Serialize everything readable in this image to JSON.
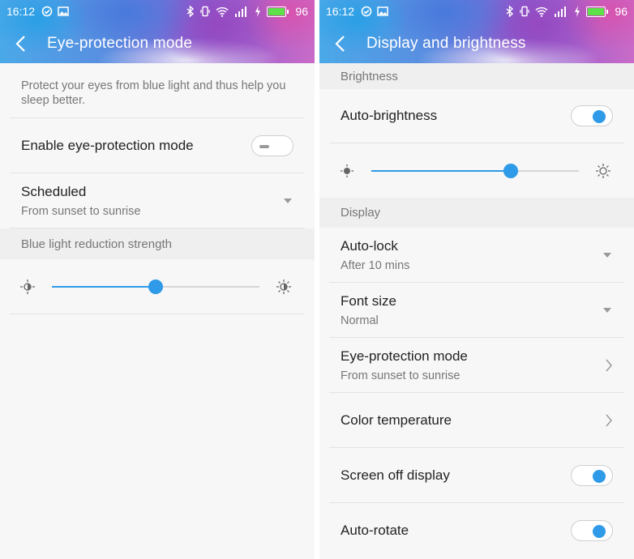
{
  "status_bar": {
    "time": "16:12",
    "battery": "96",
    "battery_level": 0.96,
    "left_icons": [
      "check-circle-icon",
      "image-icon"
    ],
    "right_icons": [
      "bluetooth-icon",
      "vibrate-icon",
      "wifi-icon",
      "signal-icon",
      "charging-icon",
      "battery-icon"
    ]
  },
  "left_screen": {
    "title": "Eye-protection mode",
    "description": "Protect your eyes from blue light and thus help you sleep better.",
    "enable": {
      "label": "Enable eye-protection mode",
      "on": false
    },
    "scheduled": {
      "label": "Scheduled",
      "value": "From sunset to sunrise"
    },
    "section_strength": "Blue light reduction strength",
    "strength_level": 0.5
  },
  "right_screen": {
    "title": "Display and brightness",
    "section_brightness": "Brightness",
    "auto_brightness": {
      "label": "Auto-brightness",
      "on": true
    },
    "brightness_level": 0.67,
    "section_display": "Display",
    "auto_lock": {
      "label": "Auto-lock",
      "value": "After 10 mins"
    },
    "font_size": {
      "label": "Font size",
      "value": "Normal"
    },
    "eye_protection": {
      "label": "Eye-protection mode",
      "value": "From sunset to sunrise"
    },
    "color_temperature": {
      "label": "Color temperature"
    },
    "screen_off_display": {
      "label": "Screen off display",
      "on": true
    },
    "auto_rotate": {
      "label": "Auto-rotate",
      "on": true
    }
  },
  "colors": {
    "accent": "#2f9ae8",
    "battery_green": "#5ee04a",
    "section_bg": "#efefef"
  }
}
